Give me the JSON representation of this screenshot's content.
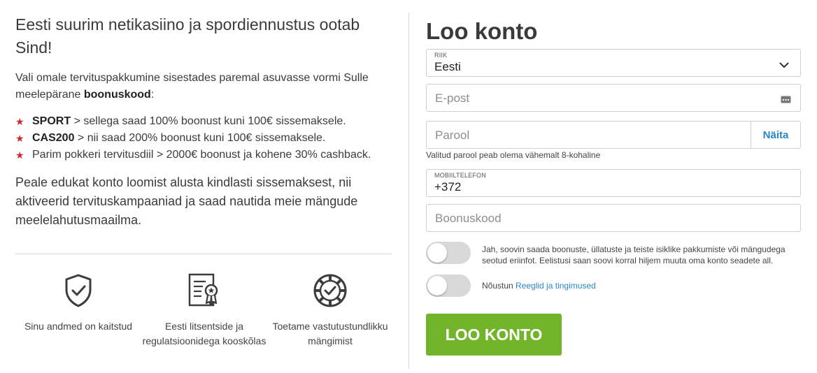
{
  "left": {
    "headline": "Eesti suurim netikasiino ja spordiennustus ootab Sind!",
    "intro_text": "Vali omale tervituspakkumine sisestades paremal asuvasse vormi Sulle meelepärane ",
    "intro_bold": "boonuskood",
    "intro_suffix": ":",
    "offers": [
      {
        "code": "SPORT",
        "text": " > sellega saad 100% boonust kuni 100€ sissemaksele."
      },
      {
        "code": "CAS200",
        "text": " > nii saad 200% boonust kuni 100€ sissemaksele."
      },
      {
        "code": "",
        "text": "Parim pokkeri tervitusdiil > 2000€ boonust ja kohene 30% cashback."
      }
    ],
    "outro": "Peale edukat konto loomist alusta kindlasti sissemaksest, nii aktiveerid tervituskampaaniad ja saad nautida meie mängude meelelahutusmaailma.",
    "features": [
      {
        "icon": "shield-check-icon",
        "text": "Sinu andmed on kaitstud"
      },
      {
        "icon": "license-certificate-icon",
        "text": "Eesti litsentside ja regulatsioonidega kooskõlas"
      },
      {
        "icon": "poker-chip-icon",
        "text": "Toetame vastutustundlikku mängimist"
      }
    ]
  },
  "form": {
    "title": "Loo konto",
    "country": {
      "label": "RIIK",
      "value": "Eesti"
    },
    "email": {
      "placeholder": "E-post"
    },
    "password": {
      "placeholder": "Parool",
      "show_label": "Näita",
      "hint": "Valitud parool peab olema vähemalt 8-kohaline"
    },
    "phone": {
      "label": "MOBIILTELEFON",
      "value": "+372"
    },
    "bonus": {
      "placeholder": "Boonuskood"
    },
    "marketing_consent": {
      "text": "Jah, soovin saada boonuste, üllatuste ja teiste isiklike pakkumiste või mängudega seotud eriinfot. Eelistusi saan soovi korral hiljem muuta oma konto seadete all.",
      "checked": false
    },
    "terms_consent": {
      "prefix": "Nõustun ",
      "link": "Reeglid ja tingimused",
      "checked": false
    },
    "submit_label": "LOO KONTO"
  },
  "colors": {
    "accent_green": "#72b42a",
    "link_blue": "#2a86c9",
    "star_red": "#d6252a"
  }
}
